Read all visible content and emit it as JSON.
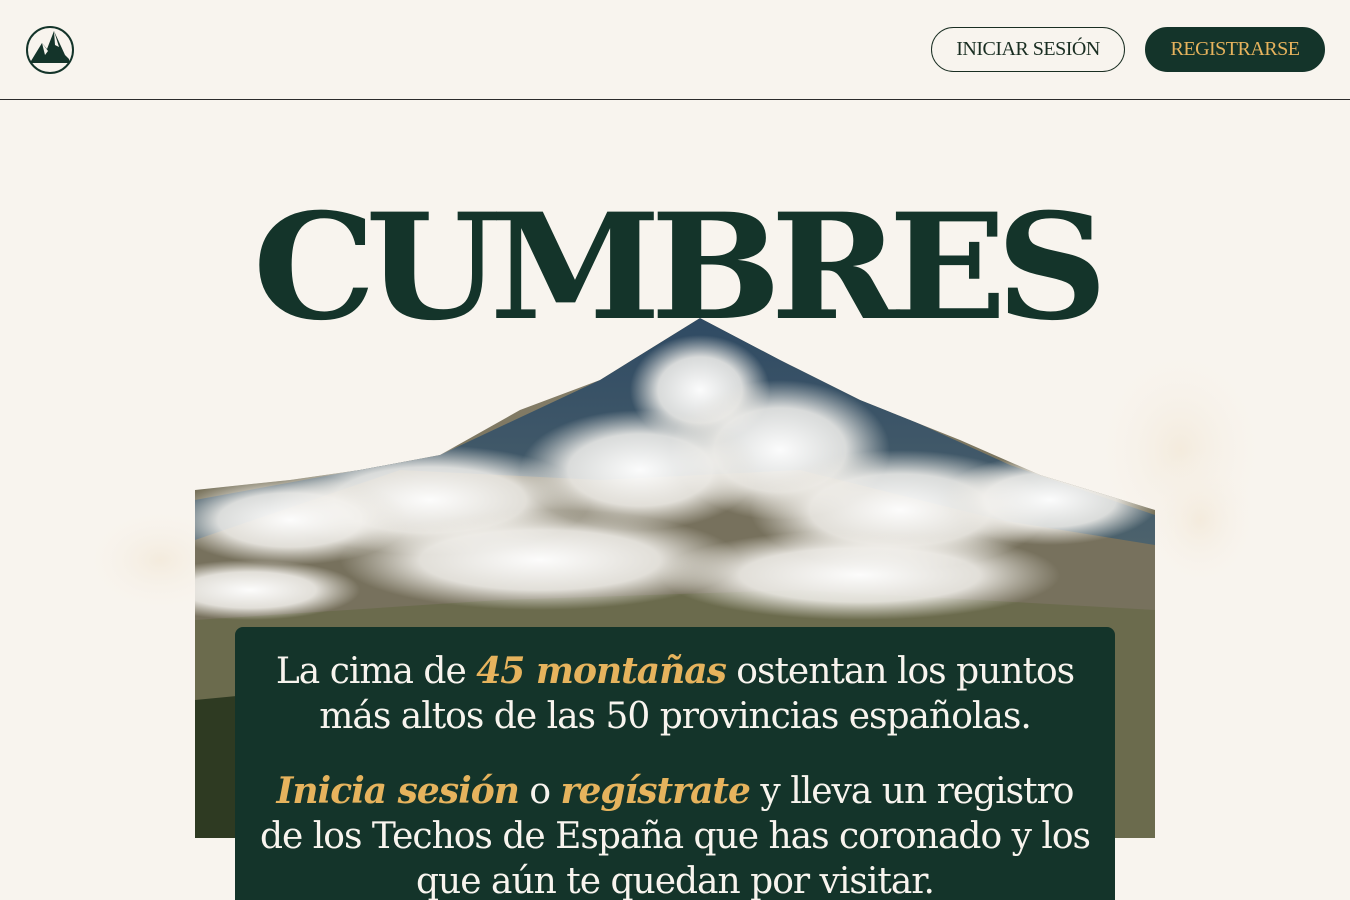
{
  "header": {
    "logo_icon": "mountain-logo-icon",
    "login_label": "INICIAR SESIÓN",
    "register_label": "REGISTRARSE"
  },
  "hero": {
    "title": "CUMBRES",
    "image": "volcano-with-clouds"
  },
  "card": {
    "line1_pre": "La cima de ",
    "line1_highlight": "45 montañas",
    "line1_post": " ostentan los puntos más altos de las 50 provincias españolas.",
    "line2_link1": "Inicia sesión",
    "line2_mid": " o ",
    "line2_link2": "regístrate",
    "line2_post": " y lleva un registro de los Techos de España que has coronado y los que aún te quedan por visitar."
  },
  "colors": {
    "background": "#f8f4ee",
    "dark_green": "#14342a",
    "gold": "#e6b35d",
    "cream_text": "#f8f4ee"
  }
}
